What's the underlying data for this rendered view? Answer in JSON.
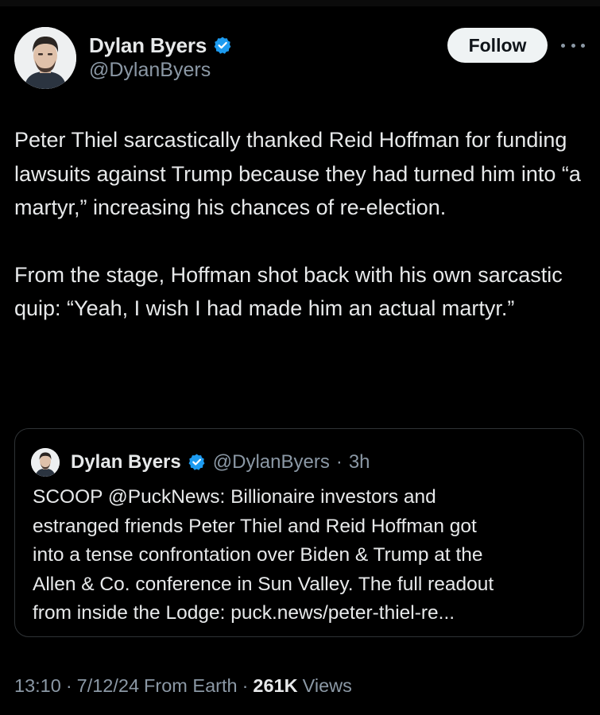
{
  "post": {
    "author": {
      "name": "Dylan Byers",
      "handle": "@DylanByers",
      "verified": true
    },
    "follow_label": "Follow",
    "more_label": "More",
    "paragraphs": [
      "Peter Thiel sarcastically thanked Reid Hoffman for funding lawsuits against Trump because they had turned him into “a martyr,” increasing his chances of re-election.",
      "From the stage, Hoffman shot back with his own sarcastic quip: “Yeah, I wish I had made him an actual martyr.”"
    ],
    "meta": {
      "time": "13:10",
      "date": "7/12/24",
      "source": "From Earth",
      "views_count": "261K",
      "views_label": "Views",
      "separator": "·"
    }
  },
  "quote": {
    "author": {
      "name": "Dylan Byers",
      "handle": "@DylanByers",
      "verified": true
    },
    "separator": "·",
    "time": "3h",
    "lines": [
      "SCOOP @PuckNews: Billionaire investors and",
      "estranged friends Peter Thiel and Reid Hoffman got",
      "into a tense confrontation over Biden & Trump at the",
      "Allen & Co. conference in Sun Valley. The full readout",
      "from inside the Lodge: puck.news/peter-thiel-re..."
    ]
  },
  "colors": {
    "background": "#000000",
    "text_primary": "#e7e9ea",
    "text_secondary": "#8b98a5",
    "verified_blue": "#1d9bf0",
    "follow_bg": "#eff3f4",
    "border": "#2f3336"
  },
  "icons": {
    "verified": "verified-badge-icon",
    "more": "more-horizontal-icon"
  }
}
